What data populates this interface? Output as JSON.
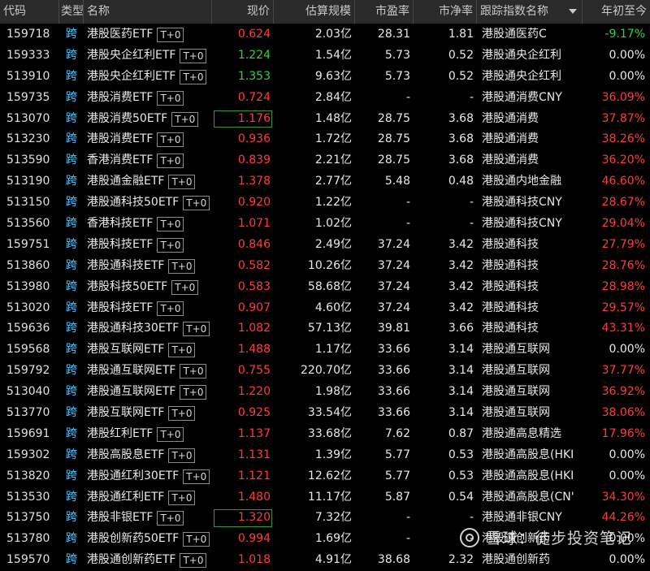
{
  "header": {
    "code": "代码",
    "type": "类型",
    "name": "名称",
    "price": "现价",
    "scale": "估算规模",
    "pe": "市盈率",
    "pb": "市净率",
    "index": "跟踪指数名称",
    "ytd": "年初至今"
  },
  "rows": [
    {
      "code": "159718",
      "type": "跨",
      "name": "港股医药ETF",
      "tag": "T+0",
      "price": "0.624",
      "dir": "up",
      "scale": "2.03亿",
      "pe": "28.31",
      "pb": "1.81",
      "index": "港股通医药C",
      "ytd": "-9.17%",
      "ytd_dir": "down"
    },
    {
      "code": "159333",
      "type": "跨",
      "name": "港股央企红利ETF",
      "tag": "T+0",
      "price": "1.224",
      "dir": "down",
      "scale": "1.54亿",
      "pe": "5.73",
      "pb": "0.52",
      "index": "港股通央企红利",
      "ytd": "0.00%",
      "ytd_dir": "flat"
    },
    {
      "code": "513910",
      "type": "跨",
      "name": "港股央企红利ETF",
      "tag": "T+0",
      "price": "1.353",
      "dir": "down",
      "scale": "9.63亿",
      "pe": "5.73",
      "pb": "0.52",
      "index": "港股通央企红利",
      "ytd": "0.00%",
      "ytd_dir": "flat"
    },
    {
      "code": "159735",
      "type": "跨",
      "name": "港股消费ETF",
      "tag": "T+0",
      "price": "0.724",
      "dir": "up",
      "scale": "2.84亿",
      "pe": "-",
      "pb": "-",
      "index": "港股通消费CNY",
      "ytd": "36.09%",
      "ytd_dir": "up"
    },
    {
      "code": "513070",
      "type": "跨",
      "name": "港股消费50ETF",
      "tag": "T+0",
      "price": "1.176",
      "dir": "up",
      "boxed": true,
      "scale": "1.48亿",
      "pe": "28.75",
      "pb": "3.68",
      "index": "港股通消费",
      "ytd": "37.87%",
      "ytd_dir": "up"
    },
    {
      "code": "513230",
      "type": "跨",
      "name": "港股消费ETF",
      "tag": "T+0",
      "price": "0.936",
      "dir": "up",
      "scale": "1.72亿",
      "pe": "28.75",
      "pb": "3.68",
      "index": "港股通消费",
      "ytd": "38.26%",
      "ytd_dir": "up"
    },
    {
      "code": "513590",
      "type": "跨",
      "name": "香港消费ETF",
      "tag": "T+0",
      "price": "0.839",
      "dir": "up",
      "scale": "2.21亿",
      "pe": "28.75",
      "pb": "3.68",
      "index": "港股通消费",
      "ytd": "36.20%",
      "ytd_dir": "up"
    },
    {
      "code": "513190",
      "type": "跨",
      "name": "港股通金融ETF",
      "tag": "T+0",
      "price": "1.378",
      "dir": "up",
      "scale": "2.77亿",
      "pe": "5.48",
      "pb": "0.48",
      "index": "港股通内地金融",
      "ytd": "46.60%",
      "ytd_dir": "up"
    },
    {
      "code": "513150",
      "type": "跨",
      "name": "港股通科技50ETF",
      "tag": "T+0",
      "price": "0.920",
      "dir": "up",
      "scale": "1.22亿",
      "pe": "-",
      "pb": "-",
      "index": "港股通科技CNY",
      "ytd": "28.67%",
      "ytd_dir": "up"
    },
    {
      "code": "513560",
      "type": "跨",
      "name": "香港科技ETF",
      "tag": "T+0",
      "price": "1.071",
      "dir": "up",
      "scale": "1.02亿",
      "pe": "-",
      "pb": "-",
      "index": "港股通科技CNY",
      "ytd": "29.04%",
      "ytd_dir": "up"
    },
    {
      "code": "159751",
      "type": "跨",
      "name": "港股科技ETF",
      "tag": "T+0",
      "price": "0.846",
      "dir": "up",
      "scale": "2.49亿",
      "pe": "37.24",
      "pb": "3.42",
      "index": "港股通科技",
      "ytd": "27.79%",
      "ytd_dir": "up"
    },
    {
      "code": "513860",
      "type": "跨",
      "name": "港股通科技ETF",
      "tag": "T+0",
      "price": "0.582",
      "dir": "up",
      "scale": "10.26亿",
      "pe": "37.24",
      "pb": "3.42",
      "index": "港股通科技",
      "ytd": "28.76%",
      "ytd_dir": "up"
    },
    {
      "code": "513980",
      "type": "跨",
      "name": "港股科技50ETF",
      "tag": "T+0",
      "price": "0.583",
      "dir": "up",
      "scale": "58.68亿",
      "pe": "37.24",
      "pb": "3.42",
      "index": "港股通科技",
      "ytd": "28.98%",
      "ytd_dir": "up"
    },
    {
      "code": "513020",
      "type": "跨",
      "name": "港股科技ETF",
      "tag": "T+0",
      "price": "0.907",
      "dir": "up",
      "scale": "4.60亿",
      "pe": "37.24",
      "pb": "3.42",
      "index": "港股通科技",
      "ytd": "29.57%",
      "ytd_dir": "up"
    },
    {
      "code": "159636",
      "type": "跨",
      "name": "港股通科技30ETF",
      "tag": "T+0",
      "price": "1.082",
      "dir": "up",
      "scale": "57.13亿",
      "pe": "39.81",
      "pb": "3.66",
      "index": "港股通科技",
      "ytd": "43.31%",
      "ytd_dir": "up"
    },
    {
      "code": "159568",
      "type": "跨",
      "name": "港股互联网ETF",
      "tag": "T+0",
      "price": "1.488",
      "dir": "up",
      "scale": "1.17亿",
      "pe": "33.66",
      "pb": "3.14",
      "index": "港股通互联网",
      "ytd": "0.00%",
      "ytd_dir": "flat"
    },
    {
      "code": "159792",
      "type": "跨",
      "name": "港股通互联网ETF",
      "tag": "T+0",
      "price": "0.755",
      "dir": "up",
      "scale": "220.70亿",
      "pe": "33.66",
      "pb": "3.14",
      "index": "港股通互联网",
      "ytd": "37.77%",
      "ytd_dir": "up"
    },
    {
      "code": "513040",
      "type": "跨",
      "name": "港股通互联网ETF",
      "tag": "T+0",
      "price": "1.220",
      "dir": "up",
      "scale": "1.98亿",
      "pe": "33.66",
      "pb": "3.14",
      "index": "港股通互联网",
      "ytd": "36.92%",
      "ytd_dir": "up"
    },
    {
      "code": "513770",
      "type": "跨",
      "name": "港股互联网ETF",
      "tag": "T+0",
      "price": "0.925",
      "dir": "up",
      "scale": "33.54亿",
      "pe": "33.66",
      "pb": "3.14",
      "index": "港股通互联网",
      "ytd": "38.06%",
      "ytd_dir": "up"
    },
    {
      "code": "159691",
      "type": "跨",
      "name": "港股红利ETF",
      "tag": "T+0",
      "price": "1.137",
      "dir": "up",
      "scale": "33.68亿",
      "pe": "7.62",
      "pb": "0.87",
      "index": "港股通高息精选",
      "ytd": "17.96%",
      "ytd_dir": "up"
    },
    {
      "code": "159302",
      "type": "跨",
      "name": "港股高股息ETF",
      "tag": "T+0",
      "price": "1.131",
      "dir": "up",
      "scale": "1.39亿",
      "pe": "5.77",
      "pb": "0.53",
      "index": "港股通高股息(HKI",
      "ytd": "0.00%",
      "ytd_dir": "flat"
    },
    {
      "code": "513820",
      "type": "跨",
      "name": "港股通红利30ETF",
      "tag": "T+0",
      "price": "1.121",
      "dir": "up",
      "scale": "12.62亿",
      "pe": "5.77",
      "pb": "0.53",
      "index": "港股通高股息(HKI",
      "ytd": "0.00%",
      "ytd_dir": "flat"
    },
    {
      "code": "513530",
      "type": "跨",
      "name": "港股通红利ETF",
      "tag": "T+0",
      "price": "1.480",
      "dir": "up",
      "scale": "11.17亿",
      "pe": "5.87",
      "pb": "0.54",
      "index": "港股通高股息(CN'",
      "ytd": "34.30%",
      "ytd_dir": "up"
    },
    {
      "code": "513750",
      "type": "跨",
      "name": "港股非银ETF",
      "tag": "T+0",
      "price": "1.320",
      "dir": "up",
      "boxed": true,
      "scale": "7.32亿",
      "pe": "-",
      "pb": "-",
      "index": "港股通非银CNY",
      "ytd": "44.26%",
      "ytd_dir": "up"
    },
    {
      "code": "513780",
      "type": "跨",
      "name": "港股创新药50ETF",
      "tag": "T+0",
      "price": "0.994",
      "dir": "up",
      "scale": "1.69亿",
      "pe": "-",
      "pb": "-",
      "index": "港股通创新药",
      "ytd": "0.00%",
      "ytd_dir": "flat"
    },
    {
      "code": "159570",
      "type": "跨",
      "name": "港股通创新药ETF",
      "tag": "T+0",
      "price": "1.018",
      "dir": "up",
      "scale": "4.91亿",
      "pe": "38.68",
      "pb": "2.32",
      "index": "港股通创新药",
      "ytd": "0.00%",
      "ytd_dir": "flat"
    }
  ],
  "watermark": {
    "text": "雪球：徒步投资笔记",
    "logo_icon": "snowball-logo-icon"
  },
  "colors": {
    "up": "#ff3b3b",
    "down": "#2ed62e",
    "type": "#4fc3ff",
    "header_bg": "#2a2a2a",
    "background": "#000000"
  }
}
